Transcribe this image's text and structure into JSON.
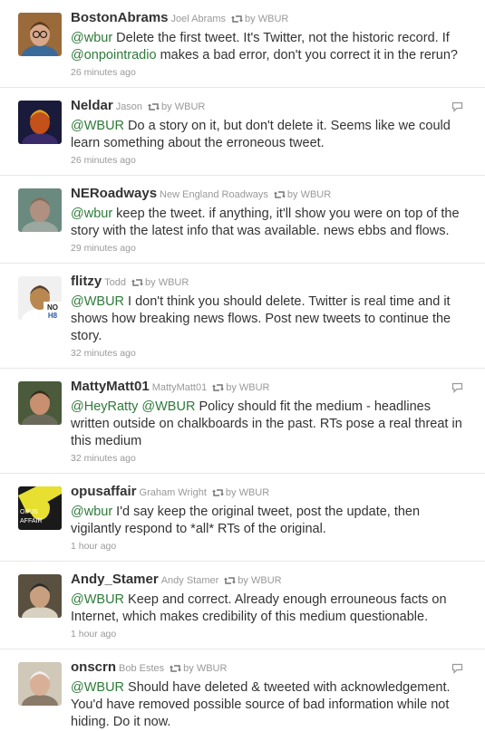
{
  "tweets": [
    {
      "screen_name": "BostonAbrams",
      "full_name": "Joel Abrams",
      "retweet_by": "by WBUR",
      "segments": [
        {
          "mention": "@wbur"
        },
        {
          "text": " Delete the first tweet. It's Twitter, not the historic record. If "
        },
        {
          "mention": "@onpointradio"
        },
        {
          "text": " makes a bad error, don't you correct it in the rerun?"
        }
      ],
      "time": "26 minutes ago",
      "has_reply": false,
      "avatar": {
        "bg": "#9a6a3a",
        "skin": "#d8a888",
        "hair": "#5a3a20",
        "shirt": "#3a6a9a",
        "glasses": true
      }
    },
    {
      "screen_name": "Neldar",
      "full_name": "Jason",
      "retweet_by": "by WBUR",
      "segments": [
        {
          "mention": "@WBUR"
        },
        {
          "text": " Do a story on it, but don't delete it. Seems like we could learn something about the erroneous tweet."
        }
      ],
      "time": "26 minutes ago",
      "has_reply": true,
      "avatar": {
        "bg": "#1a1a3a",
        "skin": "#c4501a",
        "hair": "#e0a020",
        "shirt": "#3a2a6a",
        "glasses": false
      }
    },
    {
      "screen_name": "NERoadways",
      "full_name": "New England Roadways",
      "retweet_by": "by WBUR",
      "segments": [
        {
          "mention": "@wbur"
        },
        {
          "text": " keep the tweet. if anything, it'll show you were on top of the story with the latest info that was available. news ebbs and flows."
        }
      ],
      "time": "29 minutes ago",
      "has_reply": false,
      "avatar": {
        "bg": "#6a8a80",
        "skin": "#b09080",
        "hair": "#8a6a5a",
        "shirt": "#9aa8a0",
        "glasses": false
      }
    },
    {
      "screen_name": "flitzy",
      "full_name": "Todd",
      "retweet_by": "by WBUR",
      "segments": [
        {
          "mention": "@WBUR"
        },
        {
          "text": " I don't think you should delete. Twitter is real time and it shows how breaking news flows. Post new tweets to continue the story."
        }
      ],
      "time": "32 minutes ago",
      "has_reply": false,
      "avatar": {
        "bg": "#f0f0f0",
        "skin": "#b88850",
        "hair": "#5a4030",
        "shirt": "#ffffff",
        "glasses": false,
        "badge": "NO H8"
      }
    },
    {
      "screen_name": "MattyMatt01",
      "full_name": "MattyMatt01",
      "retweet_by": "by WBUR",
      "segments": [
        {
          "mention": "@HeyRatty"
        },
        {
          "text": " "
        },
        {
          "mention": "@WBUR"
        },
        {
          "text": " Policy should fit the medium - headlines written outside on chalkboards in the past. RTs pose a real threat in this medium"
        }
      ],
      "time": "32 minutes ago",
      "has_reply": true,
      "avatar": {
        "bg": "#4a5a3a",
        "skin": "#c89070",
        "hair": "#3a2a1a",
        "shirt": "#6a6a5a",
        "glasses": false
      }
    },
    {
      "screen_name": "opusaffair",
      "full_name": "Graham Wright",
      "retweet_by": "by WBUR",
      "segments": [
        {
          "mention": "@wbur"
        },
        {
          "text": " I'd say keep the original tweet, post the update, then vigilantly respond to *all* RTs of the original."
        }
      ],
      "time": "1 hour ago",
      "has_reply": false,
      "avatar": {
        "bg": "#1a1a1a",
        "skin": "#e8e030",
        "hair": "#1a1a1a",
        "shirt": "#1a1a1a",
        "glasses": false,
        "logo": "OPUS AFFAIR"
      }
    },
    {
      "screen_name": "Andy_Stamer",
      "full_name": "Andy Stamer",
      "retweet_by": "by WBUR",
      "segments": [
        {
          "mention": "@WBUR"
        },
        {
          "text": " Keep and correct. Already enough errouneous facts on Internet, which makes credibility of this medium questionable."
        }
      ],
      "time": "1 hour ago",
      "has_reply": false,
      "avatar": {
        "bg": "#5a5040",
        "skin": "#c8a080",
        "hair": "#2a2a2a",
        "shirt": "#d8d0c0",
        "glasses": false
      }
    },
    {
      "screen_name": "onscrn",
      "full_name": "Bob Estes",
      "retweet_by": "by WBUR",
      "segments": [
        {
          "mention": "@WBUR"
        },
        {
          "text": " Should have deleted & tweeted with acknowledgement. You'd have removed possible source of bad information while not hiding. Do it now."
        }
      ],
      "time": "1 hour ago",
      "has_reply": true,
      "avatar": {
        "bg": "#d0c8b8",
        "skin": "#d8b098",
        "hair": "#f0f0f0",
        "shirt": "#8a7a6a",
        "glasses": false
      }
    }
  ]
}
